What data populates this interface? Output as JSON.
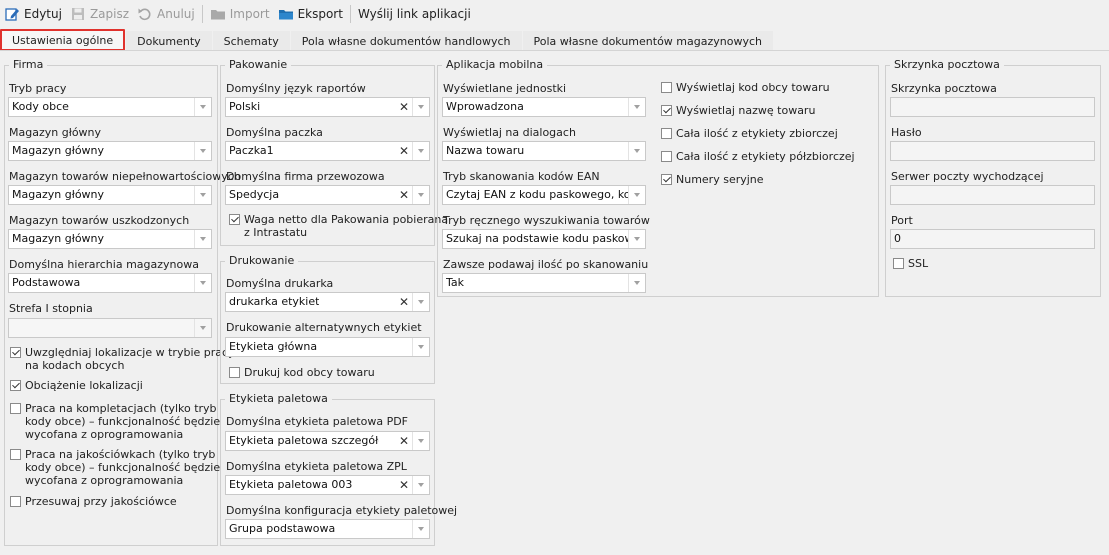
{
  "toolbar": {
    "edit": "Edytuj",
    "save": "Zapisz",
    "cancel": "Anuluj",
    "import": "Import",
    "export": "Eksport",
    "send_link": "Wyślij link aplikacji"
  },
  "tabs": [
    {
      "label": "Ustawienia ogólne",
      "active": true
    },
    {
      "label": "Dokumenty"
    },
    {
      "label": "Schematy"
    },
    {
      "label": "Pola własne dokumentów handlowych"
    },
    {
      "label": "Pola własne dokumentów magazynowych"
    }
  ],
  "firma": {
    "title": "Firma",
    "tryb_pracy_label": "Tryb pracy",
    "tryb_pracy_value": "Kody obce",
    "magazyn_glowny_label": "Magazyn główny",
    "magazyn_glowny_value": "Magazyn główny",
    "magazyn_niepeln_label": "Magazyn towarów niepełnowartościowych",
    "magazyn_niepeln_value": "Magazyn główny",
    "magazyn_uszk_label": "Magazyn towarów uszkodzonych",
    "magazyn_uszk_value": "Magazyn główny",
    "hierarchia_label": "Domyślna hierarchia magazynowa",
    "hierarchia_value": "Podstawowa",
    "strefa_label": "Strefa I stopnia",
    "strefa_value": "",
    "chk1_line1": "Uwzględniaj lokalizacje w trybie pracy",
    "chk1_line2": "na kodach obcych",
    "chk2": "Obciążenie lokalizacji",
    "chk3_line1": "Praca na kompletacjach (tylko tryb",
    "chk3_line2": "kody obce) – funkcjonalność będzie",
    "chk3_line3": "wycofana z oprogramowania",
    "chk4_line1": "Praca na jakościówkach (tylko tryb",
    "chk4_line2": "kody obce) – funkcjonalność będzie",
    "chk4_line3": "wycofana z oprogramowania",
    "chk5": "Przesuwaj przy jakościówce"
  },
  "pakowanie": {
    "title": "Pakowanie",
    "jezyk_label": "Domyślny język raportów",
    "jezyk_value": "Polski",
    "paczka_label": "Domyślna paczka",
    "paczka_value": "Paczka1",
    "firma_label": "Domyślna firma przewozowa",
    "firma_value": "Spedycja",
    "waga_line1": "Waga netto dla Pakowania pobierana",
    "waga_line2": "z Intrastatu"
  },
  "drukowanie": {
    "title": "Drukowanie",
    "drukarka_label": "Domyślna drukarka",
    "drukarka_value": "drukarka etykiet",
    "alt_label": "Drukowanie alternatywnych etykiet",
    "alt_value": "Etykieta główna",
    "kod_obcy": "Drukuj kod obcy towaru"
  },
  "etykieta": {
    "title": "Etykieta paletowa",
    "pdf_label": "Domyślna etykieta paletowa PDF",
    "pdf_value": "Etykieta paletowa szczegółowa ...",
    "zpl_label": "Domyślna etykieta paletowa ZPL",
    "zpl_value": "Etykieta paletowa 003",
    "konf_label": "Domyślna konfiguracja etykiety paletowej",
    "konf_value": "Grupa podstawowa"
  },
  "mobilna": {
    "title": "Aplikacja mobilna",
    "jednostki_label": "Wyświetlane jednostki",
    "jednostki_value": "Wprowadzona",
    "dialogi_label": "Wyświetlaj na dialogach",
    "dialogi_value": "Nazwa towaru",
    "ean_label": "Tryb skanowania kodów EAN",
    "ean_value": "Czytaj EAN z kodu paskowego, kod...",
    "reczne_label": "Tryb ręcznego wyszukiwania towarów",
    "reczne_value": "Szukaj na podstawie kodu paskowe...",
    "ilosc_label": "Zawsze podawaj ilość po skanowaniu",
    "ilosc_value": "Tak",
    "c1": "Wyświetlaj kod obcy towaru",
    "c2": "Wyświetlaj nazwę towaru",
    "c3": "Cała ilość z etykiety zbiorczej",
    "c4": "Cała ilość z etykiety półzbiorczej",
    "c5": "Numery seryjne"
  },
  "skrzynka": {
    "title": "Skrzynka pocztowa",
    "skrzynka_label": "Skrzynka pocztowa",
    "haslo_label": "Hasło",
    "serwer_label": "Serwer poczty wychodzącej",
    "port_label": "Port",
    "port_value": "0",
    "ssl": "SSL"
  },
  "colors": {
    "accent": "#e0322d",
    "export_icon": "#1f6fb0",
    "edit_icon": "#2b6cb8"
  }
}
